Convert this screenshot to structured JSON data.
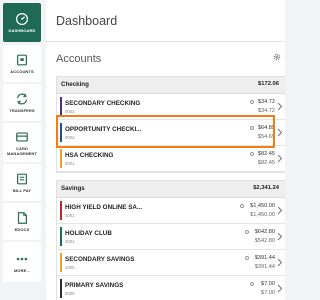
{
  "page_title": "Dashboard",
  "accounts_title": "Accounts",
  "sidebar": {
    "items": [
      {
        "label": "DASHBOARD",
        "icon": "dashboard-icon",
        "active": true
      },
      {
        "label": "ACCOUNTS",
        "icon": "accounts-icon"
      },
      {
        "label": "TRANSFERS",
        "icon": "transfers-icon"
      },
      {
        "label": "CARD MANAGEMENT",
        "icon": "card-icon"
      },
      {
        "label": "BILL PAY",
        "icon": "bill-pay-icon"
      },
      {
        "label": "EDOCS",
        "icon": "document-icon"
      },
      {
        "label": "MORE...",
        "icon": "more-icon"
      }
    ]
  },
  "groups": [
    {
      "name": "Checking",
      "total": "$172.06",
      "rows": [
        {
          "name": "SECONDARY CHECKING",
          "number": "0003",
          "balance": "$34.72",
          "available": "$34.72",
          "color": "#4b2e83"
        },
        {
          "name": "OPPORTUNITY CHECKI...",
          "number": "0002",
          "balance": "$64.89",
          "available": "$54.69",
          "color": "#2b4b8c"
        },
        {
          "name": "HSA CHECKING",
          "number": "0001",
          "balance": "$82.45",
          "available": "$82.45",
          "color": "#f0a030"
        }
      ]
    },
    {
      "name": "Savings",
      "total": "$2,341.24",
      "rows": [
        {
          "name": "HIGH YIELD ONLINE SA...",
          "number": "1001",
          "balance": "$1,450.00",
          "available": "$1,450.00",
          "color": "#c0262d"
        },
        {
          "name": "HOLIDAY CLUB",
          "number": "2001",
          "balance": "$642.80",
          "available": "$542.80",
          "color": "#1f6a57"
        },
        {
          "name": "SECONDARY SAVINGS",
          "number": "1000",
          "balance": "$391.44",
          "available": "$391.44",
          "color": "#f0a030"
        },
        {
          "name": "PRIMARY SAVINGS",
          "number": "0000",
          "balance": "$7.00",
          "available": "$7.00",
          "color": "#2f2f2f"
        }
      ]
    }
  ],
  "colors": {
    "brand": "#1f6a57",
    "highlight": "#ef7d1a"
  }
}
